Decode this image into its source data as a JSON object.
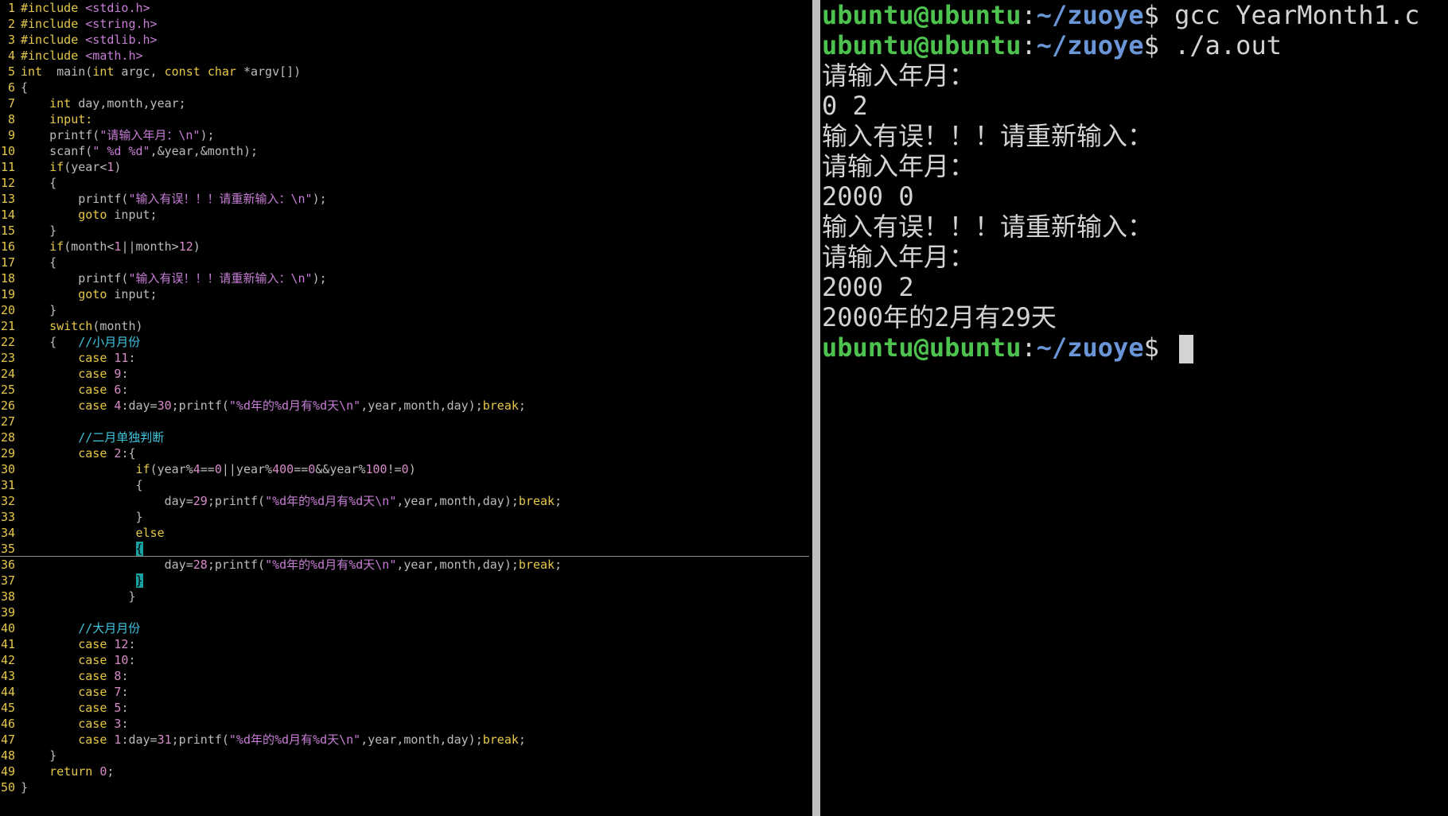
{
  "editor": {
    "lines": [
      [
        [
          "kw",
          "#include "
        ],
        [
          "str",
          "<stdio.h>"
        ]
      ],
      [
        [
          "kw",
          "#include "
        ],
        [
          "str",
          "<string.h>"
        ]
      ],
      [
        [
          "kw",
          "#include "
        ],
        [
          "str",
          "<stdlib.h>"
        ]
      ],
      [
        [
          "kw",
          "#include "
        ],
        [
          "str",
          "<math.h>"
        ]
      ],
      [
        [
          "kw",
          "int"
        ],
        [
          "",
          "  main("
        ],
        [
          "kw",
          "int"
        ],
        [
          "",
          " argc, "
        ],
        [
          "kw",
          "const"
        ],
        [
          "",
          " "
        ],
        [
          "kw",
          "char"
        ],
        [
          "",
          " *argv[])"
        ]
      ],
      [
        [
          "",
          "{"
        ]
      ],
      [
        [
          "",
          "    "
        ],
        [
          "kw",
          "int"
        ],
        [
          "",
          " day,month,year;"
        ]
      ],
      [
        [
          "lbl",
          "    input:"
        ]
      ],
      [
        [
          "",
          "    printf("
        ],
        [
          "str",
          "\"请输入年月：\\n\""
        ],
        [
          "",
          ");"
        ]
      ],
      [
        [
          "",
          "    scanf("
        ],
        [
          "str",
          "\" %d %d\""
        ],
        [
          "",
          ",&year,&month);"
        ]
      ],
      [
        [
          "",
          "    "
        ],
        [
          "kw",
          "if"
        ],
        [
          "",
          "(year<"
        ],
        [
          "num",
          "1"
        ],
        [
          "",
          ")"
        ]
      ],
      [
        [
          "",
          "    {"
        ]
      ],
      [
        [
          "",
          "        printf("
        ],
        [
          "str",
          "\"输入有误！！！请重新输入：\\n\""
        ],
        [
          "",
          ");"
        ]
      ],
      [
        [
          "",
          "        "
        ],
        [
          "kw",
          "goto"
        ],
        [
          "",
          " input;"
        ]
      ],
      [
        [
          "",
          "    }"
        ]
      ],
      [
        [
          "",
          "    "
        ],
        [
          "kw",
          "if"
        ],
        [
          "",
          "(month<"
        ],
        [
          "num",
          "1"
        ],
        [
          "",
          "||month>"
        ],
        [
          "num",
          "12"
        ],
        [
          "",
          ")"
        ]
      ],
      [
        [
          "",
          "    {"
        ]
      ],
      [
        [
          "",
          "        printf("
        ],
        [
          "str",
          "\"输入有误！！！请重新输入：\\n\""
        ],
        [
          "",
          ");"
        ]
      ],
      [
        [
          "",
          "        "
        ],
        [
          "kw",
          "goto"
        ],
        [
          "",
          " input;"
        ]
      ],
      [
        [
          "",
          "    }"
        ]
      ],
      [
        [
          "",
          "    "
        ],
        [
          "kw",
          "switch"
        ],
        [
          "",
          "(month)"
        ]
      ],
      [
        [
          "",
          "    {   "
        ],
        [
          "cmt",
          "//小月月份"
        ]
      ],
      [
        [
          "",
          "        "
        ],
        [
          "kw",
          "case"
        ],
        [
          "",
          " "
        ],
        [
          "num",
          "11"
        ],
        [
          "",
          ":"
        ]
      ],
      [
        [
          "",
          "        "
        ],
        [
          "kw",
          "case"
        ],
        [
          "",
          " "
        ],
        [
          "num",
          "9"
        ],
        [
          "",
          ":"
        ]
      ],
      [
        [
          "",
          "        "
        ],
        [
          "kw",
          "case"
        ],
        [
          "",
          " "
        ],
        [
          "num",
          "6"
        ],
        [
          "",
          ":"
        ]
      ],
      [
        [
          "",
          "        "
        ],
        [
          "kw",
          "case"
        ],
        [
          "",
          " "
        ],
        [
          "num",
          "4"
        ],
        [
          "",
          ":day="
        ],
        [
          "num",
          "30"
        ],
        [
          "",
          ";printf("
        ],
        [
          "str",
          "\"%d年的%d月有%d天\\n\""
        ],
        [
          "",
          ",year,month,day);"
        ],
        [
          "kw",
          "break"
        ],
        [
          "",
          ";"
        ]
      ],
      [],
      [
        [
          "",
          "        "
        ],
        [
          "cmt",
          "//二月单独判断"
        ]
      ],
      [
        [
          "",
          "        "
        ],
        [
          "kw",
          "case"
        ],
        [
          "",
          " "
        ],
        [
          "num",
          "2"
        ],
        [
          "",
          ":{"
        ]
      ],
      [
        [
          "",
          "                "
        ],
        [
          "kw",
          "if"
        ],
        [
          "",
          "(year%"
        ],
        [
          "num",
          "4"
        ],
        [
          "",
          "=="
        ],
        [
          "num",
          "0"
        ],
        [
          "",
          "||year%"
        ],
        [
          "num",
          "400"
        ],
        [
          "",
          "=="
        ],
        [
          "num",
          "0"
        ],
        [
          "",
          "&&year%"
        ],
        [
          "num",
          "100"
        ],
        [
          "",
          "!="
        ],
        [
          "num",
          "0"
        ],
        [
          "",
          ")"
        ]
      ],
      [
        [
          "",
          "                {"
        ]
      ],
      [
        [
          "",
          "                    day="
        ],
        [
          "num",
          "29"
        ],
        [
          "",
          ";printf("
        ],
        [
          "str",
          "\"%d年的%d月有%d天\\n\""
        ],
        [
          "",
          ",year,month,day);"
        ],
        [
          "kw",
          "break"
        ],
        [
          "",
          ";"
        ]
      ],
      [
        [
          "",
          "                }"
        ]
      ],
      [
        [
          "",
          "                "
        ],
        [
          "kw",
          "else"
        ]
      ],
      [
        [
          "",
          "                "
        ],
        [
          "match",
          "{"
        ]
      ],
      [
        [
          "",
          "                    day="
        ],
        [
          "num",
          "28"
        ],
        [
          "",
          ";printf("
        ],
        [
          "str",
          "\"%d年的%d月有%d天\\n\""
        ],
        [
          "",
          ",year,month,day);"
        ],
        [
          "kw",
          "break"
        ],
        [
          "",
          ";"
        ]
      ],
      [
        [
          "",
          "                "
        ],
        [
          "match",
          "}"
        ]
      ],
      [
        [
          "",
          "               }"
        ]
      ],
      [],
      [
        [
          "",
          "        "
        ],
        [
          "cmt",
          "//大月月份"
        ]
      ],
      [
        [
          "",
          "        "
        ],
        [
          "kw",
          "case"
        ],
        [
          "",
          " "
        ],
        [
          "num",
          "12"
        ],
        [
          "",
          ":"
        ]
      ],
      [
        [
          "",
          "        "
        ],
        [
          "kw",
          "case"
        ],
        [
          "",
          " "
        ],
        [
          "num",
          "10"
        ],
        [
          "",
          ":"
        ]
      ],
      [
        [
          "",
          "        "
        ],
        [
          "kw",
          "case"
        ],
        [
          "",
          " "
        ],
        [
          "num",
          "8"
        ],
        [
          "",
          ":"
        ]
      ],
      [
        [
          "",
          "        "
        ],
        [
          "kw",
          "case"
        ],
        [
          "",
          " "
        ],
        [
          "num",
          "7"
        ],
        [
          "",
          ":"
        ]
      ],
      [
        [
          "",
          "        "
        ],
        [
          "kw",
          "case"
        ],
        [
          "",
          " "
        ],
        [
          "num",
          "5"
        ],
        [
          "",
          ":"
        ]
      ],
      [
        [
          "",
          "        "
        ],
        [
          "kw",
          "case"
        ],
        [
          "",
          " "
        ],
        [
          "num",
          "3"
        ],
        [
          "",
          ":"
        ]
      ],
      [
        [
          "",
          "        "
        ],
        [
          "kw",
          "case"
        ],
        [
          "",
          " "
        ],
        [
          "num",
          "1"
        ],
        [
          "",
          ":day="
        ],
        [
          "num",
          "31"
        ],
        [
          "",
          ";printf("
        ],
        [
          "str",
          "\"%d年的%d月有%d天\\n\""
        ],
        [
          "",
          ",year,month,day);"
        ],
        [
          "kw",
          "break"
        ],
        [
          "",
          ";"
        ]
      ],
      [
        [
          "",
          "    }"
        ]
      ],
      [
        [
          "",
          "    "
        ],
        [
          "kw",
          "return"
        ],
        [
          "",
          " "
        ],
        [
          "num",
          "0"
        ],
        [
          "",
          ";"
        ]
      ],
      [
        [
          "",
          "}"
        ]
      ]
    ],
    "cursor_line": 35
  },
  "terminal": {
    "lines": [
      {
        "type": "prompt",
        "user": "ubuntu@ubuntu",
        "path": "~/zuoye",
        "symbol": "$",
        "cmd": " gcc YearMonth1.c"
      },
      {
        "type": "prompt",
        "user": "ubuntu@ubuntu",
        "path": "~/zuoye",
        "symbol": "$",
        "cmd": " ./a.out"
      },
      {
        "type": "out",
        "text": "请输入年月："
      },
      {
        "type": "out",
        "text": "0 2"
      },
      {
        "type": "out",
        "text": "输入有误！！！请重新输入："
      },
      {
        "type": "out",
        "text": "请输入年月："
      },
      {
        "type": "out",
        "text": "2000 0"
      },
      {
        "type": "out",
        "text": "输入有误！！！请重新输入："
      },
      {
        "type": "out",
        "text": "请输入年月："
      },
      {
        "type": "out",
        "text": "2000 2"
      },
      {
        "type": "out",
        "text": "2000年的2月有29天"
      },
      {
        "type": "prompt",
        "user": "ubuntu@ubuntu",
        "path": "~/zuoye",
        "symbol": "$",
        "cmd": " ",
        "cursor": true
      }
    ]
  }
}
